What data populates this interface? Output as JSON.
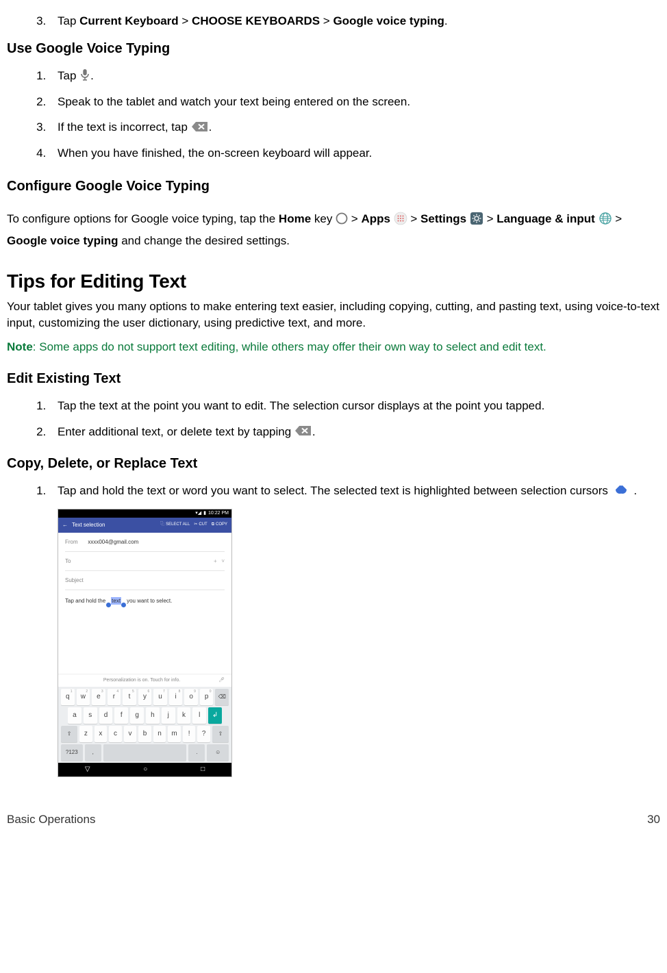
{
  "step3_prefix": "Tap ",
  "step3_b1": "Current Keyboard",
  "step3_mid1": " > ",
  "step3_b2": "CHOOSE KEYBOARDS",
  "step3_mid2": " > ",
  "step3_b3": "Google voice typing",
  "step3_suffix": ".",
  "h_use": "Use Google Voice Typing",
  "use1_a": "Tap ",
  "use1_b": ".",
  "use2": "Speak to the tablet and watch your text being entered on the screen.",
  "use3_a": "If the text is incorrect, tap ",
  "use3_b": ".",
  "use4": "When you have finished, the on-screen keyboard will appear.",
  "h_config": "Configure Google Voice Typing",
  "config_a": "To configure options for Google voice typing, tap the ",
  "config_home": "Home",
  "config_key": " key ",
  "config_gt1": " > ",
  "config_apps": "Apps",
  "config_sp1": " ",
  "config_gt2": " > ",
  "config_settings": "Settings",
  "config_sp2": "  ",
  "config_gt3": " > ",
  "config_lang": "Language & input",
  "config_sp3": "  ",
  "config_gt4": " > ",
  "config_gvt": "Google voice typing",
  "config_end": " and change the desired settings.",
  "h_tips": "Tips for Editing Text",
  "tips_body": "Your tablet gives you many options to make entering text easier, including copying, cutting, and pasting text, using voice-to-text input, customizing the user dictionary, using predictive text, and more.",
  "note_label": "Note",
  "note_body": ": Some apps do not support text editing, while others may offer their own way to select and edit text.",
  "h_edit": "Edit Existing Text",
  "edit1": "Tap the text at the point you want to edit. The selection cursor displays at the point you tapped.",
  "edit2_a": "Enter additional text, or delete text by tapping ",
  "edit2_b": ".",
  "h_copy": "Copy, Delete, or Replace Text",
  "copy1_a": "Tap and hold the text or word you want to select. The selected text is highlighted between selection cursors ",
  "copy1_b": " .",
  "footer_left": "Basic Operations",
  "footer_right": "30",
  "ss": {
    "time": "10:22 PM",
    "title": "Text selection",
    "select_all": "SELECT ALL",
    "cut": "CUT",
    "copy": "COPY",
    "from_label": "From",
    "from_val": "xxxx004@gmail.com",
    "to_label": "To",
    "subject": "Subject",
    "line_a": "Tap and hold the ",
    "line_sel": "text",
    "line_b": " you want to select.",
    "predict": "Personalization is on. Touch for info.",
    "row1": [
      "q",
      "w",
      "e",
      "r",
      "t",
      "y",
      "u",
      "i",
      "o",
      "p"
    ],
    "row1n": [
      "1",
      "2",
      "3",
      "4",
      "5",
      "6",
      "7",
      "8",
      "9",
      "0"
    ],
    "row2": [
      "a",
      "s",
      "d",
      "f",
      "g",
      "h",
      "j",
      "k",
      "l"
    ],
    "row3": [
      "z",
      "x",
      "c",
      "v",
      "b",
      "n",
      "m",
      "!",
      "?"
    ],
    "fn_shift": "⇧",
    "fn_bksp": "⌫",
    "fn_123": "?123",
    "fn_comma": ",",
    "fn_period": ".",
    "fn_emoji": "☺"
  }
}
